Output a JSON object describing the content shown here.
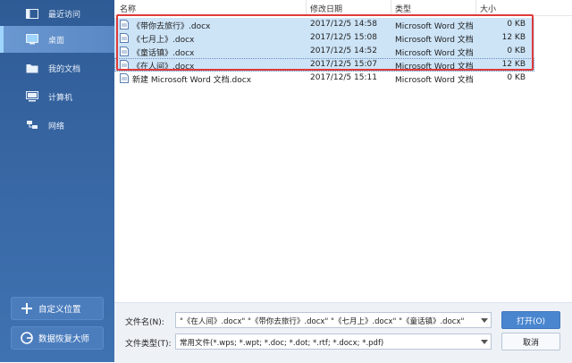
{
  "sidebar": {
    "items": [
      {
        "label": "最近访问",
        "icon": "recent-folder-icon"
      },
      {
        "label": "桌面",
        "icon": "desktop-icon"
      },
      {
        "label": "我的文档",
        "icon": "folder-icon"
      },
      {
        "label": "计算机",
        "icon": "computer-icon"
      },
      {
        "label": "网络",
        "icon": "network-icon"
      }
    ],
    "add_location_label": "自定义位置",
    "recovery_label": "数据恢复大师"
  },
  "columns": {
    "name": "名称",
    "date": "修改日期",
    "type": "类型",
    "size": "大小"
  },
  "files": [
    {
      "name": "《带你去旅行》.docx",
      "date": "2017/12/5 14:58",
      "type": "Microsoft Word 文档",
      "size": "0 KB",
      "selected": true
    },
    {
      "name": "《七月上》.docx",
      "date": "2017/12/5 15:08",
      "type": "Microsoft Word 文档",
      "size": "12 KB",
      "selected": true
    },
    {
      "name": "《童话镇》.docx",
      "date": "2017/12/5 14:52",
      "type": "Microsoft Word 文档",
      "size": "0 KB",
      "selected": true
    },
    {
      "name": "《在人间》.docx",
      "date": "2017/12/5 15:07",
      "type": "Microsoft Word 文档",
      "size": "12 KB",
      "selected": true
    },
    {
      "name": "新建 Microsoft Word 文档.docx",
      "date": "2017/12/5 15:11",
      "type": "Microsoft Word 文档",
      "size": "0 KB",
      "selected": false
    }
  ],
  "bottom": {
    "filename_label": "文件名(N):",
    "filename_value": "\"《在人间》.docx\" \"《带你去旅行》.docx\" \"《七月上》.docx\" \"《童话镇》.docx\"",
    "filetype_label": "文件类型(T):",
    "filetype_value": "常用文件(*.wps; *.wpt; *.doc; *.dot; *.rtf; *.docx; *.pdf)",
    "open_label": "打开(O)",
    "cancel_label": "取消"
  },
  "colors": {
    "sidebar": "#3a6aa8",
    "selection": "#cde4f7",
    "highlight_frame": "#e03a3a",
    "primary_button": "#4a86cf"
  }
}
